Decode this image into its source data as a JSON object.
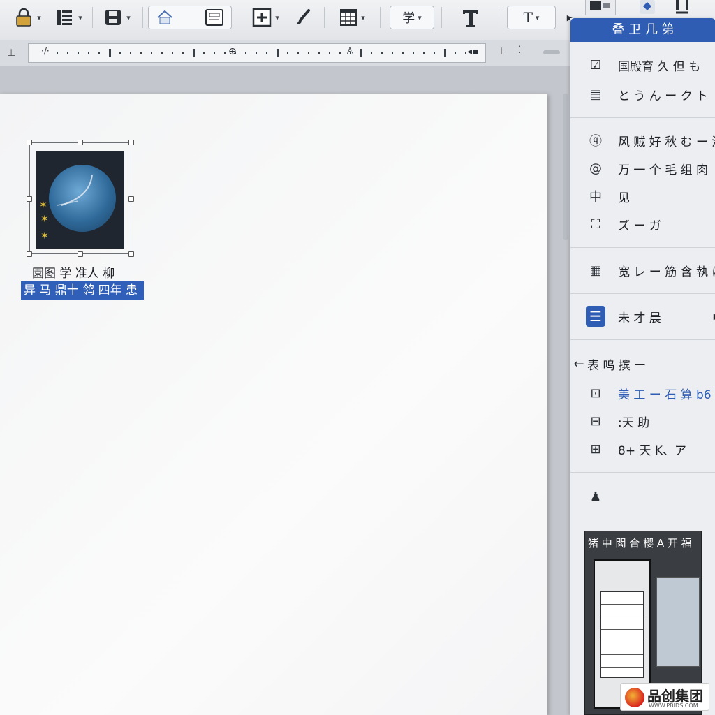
{
  "toolbar": {
    "text_style_label": "学",
    "font_label": "T",
    "font_caret": "▾"
  },
  "document": {
    "image_caption": "園图 学 准人 柳",
    "selected_caption": "异 马 鼎十 鸰 四年 患"
  },
  "panel": {
    "title": "叠 卫 几 第",
    "items": [
      {
        "label": "国殿育 久 但 も",
        "icon": "check-doc-icon"
      },
      {
        "label": "と う ん ー ク ト",
        "icon": "list-doc-icon"
      },
      {
        "label": "风 贼 好 秋 む ー 溴",
        "icon": "link-icon"
      },
      {
        "label": "万 一 个 毛 组 肉",
        "icon": "at-link-icon"
      },
      {
        "label": "见",
        "icon": "center-icon"
      },
      {
        "label": "ズ ー ガ",
        "icon": "crop-icon"
      },
      {
        "label": "宽 レ ー 筋 含 執 は",
        "icon": "table-icon"
      },
      {
        "label": "未 才 晨",
        "icon": "menu-icon"
      },
      {
        "label": "表 呜 摈 ー",
        "icon": "back-icon"
      },
      {
        "label": "美 工 ー 石 算 b6",
        "icon": "text-box-icon"
      },
      {
        "label": ":天 助",
        "icon": "stack-icon"
      },
      {
        "label": "8+ 天 K、ア",
        "icon": "frame-icon"
      }
    ],
    "center_glyph": "中",
    "submenu_arrow": "▶",
    "thumbnail_title": "猪 中 閻 合    樱 A 开 福"
  },
  "watermark": {
    "brand": "品创集团",
    "url": "WWW.PBIDS.COM"
  },
  "colors": {
    "accent": "#2e5db3",
    "toolbar_bg": "#e9ebee",
    "page_bg": "#f6f7f8"
  }
}
